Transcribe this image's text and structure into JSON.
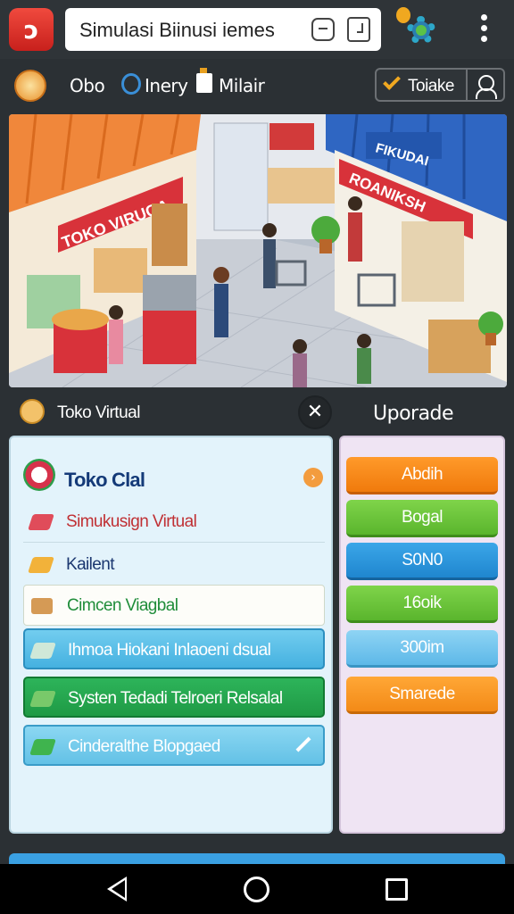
{
  "app_bar": {
    "search_text": "Simulasi Biinusi iemes",
    "icons": [
      "app-logo-icon",
      "tag-icon",
      "share-icon",
      "gear-icon",
      "more-vert-icon"
    ]
  },
  "sub_bar": {
    "items": [
      "Obo",
      "Inery",
      "Milair"
    ],
    "follow_label": "Toiake"
  },
  "hero": {
    "sign_left": "TOKO VIRUGA",
    "sign_right": "ROANIKSH",
    "sign_right_top": "FIKUDAI"
  },
  "section": {
    "title": "Toko Virtual",
    "close_symbol": "✕",
    "upgrade_title": "Uporade"
  },
  "left_panel": {
    "title": "Toko Clal",
    "badge": "›",
    "rows": [
      "Simukusign Virtual",
      "Kailent",
      "Cimcen Viagbal",
      "Ihmoa Hiokani Inlaoeni dsual",
      "Systen Tedadi Telroeri Relsalal",
      "Cinderalthe Blopgaed"
    ]
  },
  "upgrade_buttons": [
    "Abdih",
    "Bogal",
    "S0N0",
    "16oik",
    "300im",
    "Smarede"
  ],
  "colors": {
    "orange": "#f07a0c",
    "green": "#5ab52d",
    "blue": "#1f86cf",
    "light_blue": "#5db8e8",
    "dark_green": "#1f9a45",
    "title_navy": "#143a78"
  }
}
